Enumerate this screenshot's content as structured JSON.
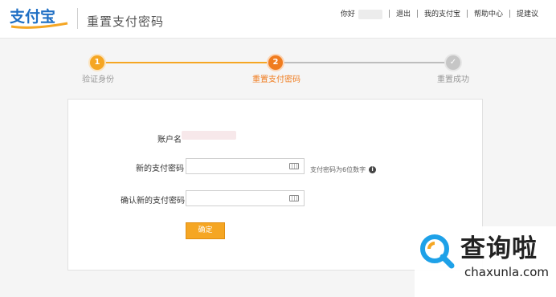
{
  "header": {
    "logo_text": "支付宝",
    "page_title": "重置支付密码",
    "nav": {
      "greeting": "你好",
      "logout": "退出",
      "my_alipay": "我的支付宝",
      "help": "帮助中心",
      "suggest": "提建议"
    }
  },
  "steps": [
    {
      "number": "1",
      "label": "验证身份",
      "state": "done"
    },
    {
      "number": "2",
      "label": "重置支付密码",
      "state": "current"
    },
    {
      "number": "✓",
      "label": "重置成功",
      "state": "pending"
    }
  ],
  "form": {
    "account_label": "账户名",
    "new_pwd_label": "新的支付密码",
    "confirm_pwd_label": "确认新的支付密码",
    "new_pwd_value": "",
    "confirm_pwd_value": "",
    "hint": "支付密码为6位数字",
    "submit_label": "确定"
  },
  "watermark": {
    "text": "查询啦",
    "url": "chaxunla.com"
  },
  "colors": {
    "accent": "#f5a623",
    "current_step": "#f07c1e",
    "pending": "#c6c6c6",
    "watermark_blue": "#1ea1e8"
  }
}
